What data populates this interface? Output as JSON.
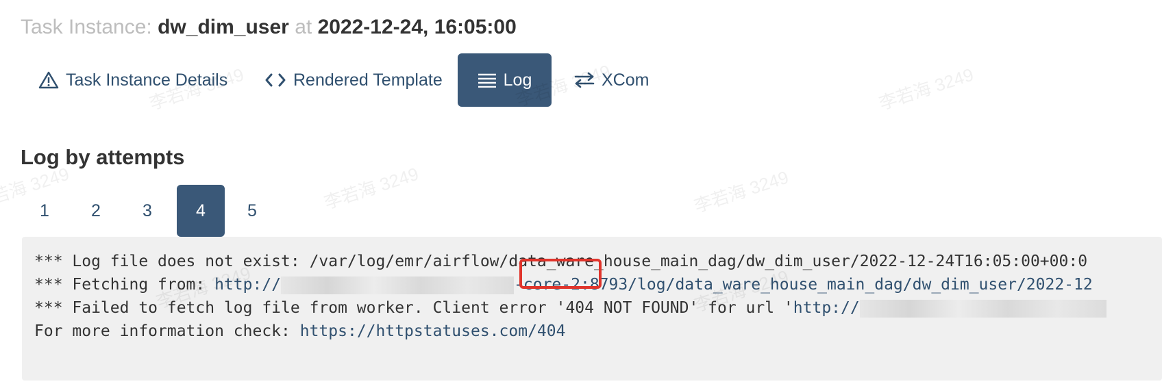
{
  "header": {
    "prefix": "Task Instance:",
    "task_id": "dw_dim_user",
    "at": "at",
    "datetime": "2022-12-24, 16:05:00"
  },
  "tabs": [
    {
      "label": "Task Instance Details",
      "icon": "warning-triangle-icon"
    },
    {
      "label": "Rendered Template",
      "icon": "code-brackets-icon"
    },
    {
      "label": "Log",
      "icon": "list-lines-icon",
      "active": true
    },
    {
      "label": "XCom",
      "icon": "exchange-arrows-icon"
    }
  ],
  "log_section": {
    "title": "Log by attempts",
    "attempts": [
      "1",
      "2",
      "3",
      "4",
      "5"
    ],
    "active_attempt": "4"
  },
  "log": {
    "line1": "*** Log file does not exist: /var/log/emr/airflow/data_ware_house_main_dag/dw_dim_user/2022-12-24T16:05:00+00:0",
    "line2_prefix": "*** Fetching from: ",
    "line2_url_start": "http://",
    "line2_url_end": "-core-2:8793/log/data_ware_house_main_dag/dw_dim_user/2022-12",
    "line3_prefix": "*** Failed to fetch log file from worker. Client error '404 NOT FOUND' for url '",
    "line3_url_start": "http://",
    "line4_prefix": "For more information check: ",
    "line4_url": "https://httpstatuses.com/404"
  },
  "watermark": "李若海 3249",
  "colors": {
    "accent": "#3a5878",
    "link": "#30506f",
    "highlight": "#e0342b",
    "log_bg": "#f0f0f0"
  }
}
